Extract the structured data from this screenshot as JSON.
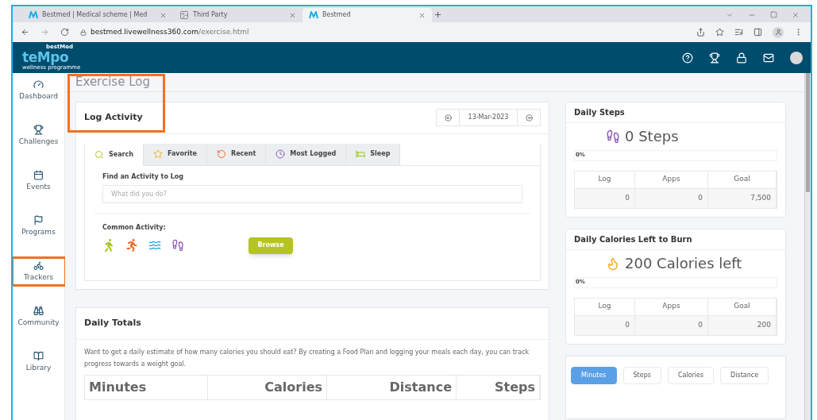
{
  "browser": {
    "tabs": [
      {
        "title": "Bestmed | Medical scheme | Med",
        "kind": "brand",
        "selected": false
      },
      {
        "title": "Third Party",
        "kind": "generic",
        "selected": false
      },
      {
        "title": "Bestmed",
        "kind": "brand",
        "selected": true
      }
    ],
    "url_host": "bestmed.livewellness360.com",
    "url_path": "/exercise.html"
  },
  "header": {
    "logo_top": "bestMed",
    "logo_main": "teMpo",
    "logo_sub": "wellness programme"
  },
  "sidebar": {
    "items": [
      {
        "label": "Dashboard",
        "highlighted": false
      },
      {
        "label": "Challenges",
        "highlighted": false
      },
      {
        "label": "Events",
        "highlighted": false
      },
      {
        "label": "Programs",
        "highlighted": false
      },
      {
        "label": "Trackers",
        "highlighted": true
      },
      {
        "label": "Community",
        "highlighted": false
      },
      {
        "label": "Library",
        "highlighted": false
      }
    ]
  },
  "page_title": "Exercise Log",
  "title_highlighted": true,
  "log_activity": {
    "title": "Log Activity",
    "date": "13-Mar-2023",
    "tabs": [
      {
        "label": "Search",
        "selected": true
      },
      {
        "label": "Favorite",
        "selected": false
      },
      {
        "label": "Recent",
        "selected": false
      },
      {
        "label": "Most Logged",
        "selected": false
      },
      {
        "label": "Sleep",
        "selected": false
      }
    ],
    "search_label": "Find an Activity to Log",
    "search_placeholder": "What did you do?",
    "common_label": "Common Activity:",
    "browse": "Browse"
  },
  "daily_totals": {
    "title": "Daily Totals",
    "text": "Want to get a daily estimate of how many calories you should eat? By creating a Food Plan and logging your meals each day, you can track progress towards a weight goal.",
    "columns": [
      "Minutes",
      "Calories",
      "Distance",
      "Steps"
    ]
  },
  "widgets": [
    {
      "title": "Daily Steps",
      "headline": "0 Steps",
      "level": 0,
      "percent": "0%",
      "columns": [
        "Log",
        "Apps",
        "Goal"
      ],
      "values": [
        "0",
        "0",
        "7,500"
      ]
    },
    {
      "title": "Daily Calories Left to Burn",
      "headline": "200 Calories left",
      "level": 0,
      "percent": "0%",
      "columns": [
        "Log",
        "Apps",
        "Goal"
      ],
      "values": [
        "0",
        "0",
        "200"
      ]
    }
  ],
  "chart_toggles": [
    {
      "label": "Minutes",
      "selected": true
    },
    {
      "label": "Steps",
      "selected": false
    },
    {
      "label": "Calories",
      "selected": false
    },
    {
      "label": "Distance",
      "selected": false
    }
  ]
}
